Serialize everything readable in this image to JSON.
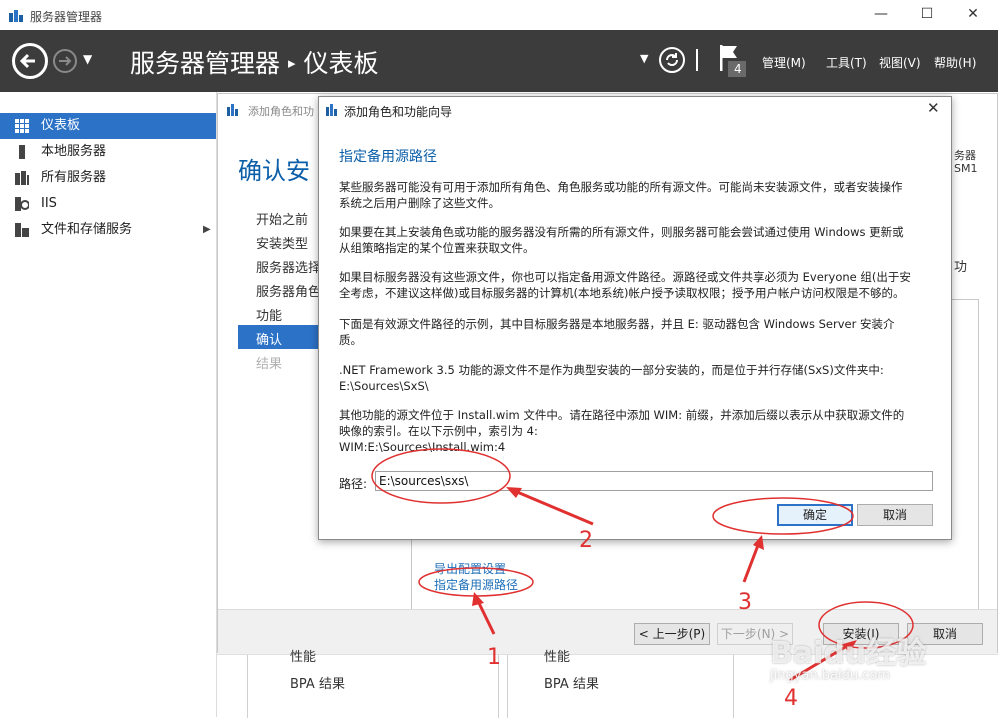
{
  "window": {
    "title": "服务器管理器"
  },
  "header": {
    "breadcrumb_app": "服务器管理器",
    "breadcrumb_sep": "▸",
    "breadcrumb_page": "仪表板",
    "notification_count": "4",
    "menus": [
      "管理(M)",
      "工具(T)",
      "视图(V)",
      "帮助(H)"
    ]
  },
  "leftnav": {
    "items": [
      "仪表板",
      "本地服务器",
      "所有服务器",
      "IIS",
      "文件和存储服务"
    ],
    "active_index": 0
  },
  "bg_wizard": {
    "title": "添加角色和功",
    "heading": "确认安",
    "steps": [
      "开始之前",
      "安装类型",
      "服务器选择",
      "服务器角色",
      "功能",
      "确认",
      "结果"
    ],
    "active_step": 5,
    "right_text_1": "务器",
    "right_text_2": "SM1",
    "right_text_3": "功",
    "export_link": "导出配置设置",
    "source_link": "指定备用源路径",
    "buttons": {
      "prev": "< 上一步(P)",
      "next": "下一步(N) >",
      "install": "安装(I)",
      "cancel": "取消"
    }
  },
  "bottom": {
    "left_a": "性能",
    "left_b": "BPA 结果",
    "right_a": "性能",
    "right_b": "BPA 结果"
  },
  "dialog": {
    "title": "添加角色和功能向导",
    "heading": "指定备用源路径",
    "paragraphs": [
      "某些服务器可能没有可用于添加所有角色、角色服务或功能的所有源文件。可能尚未安装源文件，或者安装操作\n系统之后用户删除了这些文件。",
      "如果要在其上安装角色或功能的服务器没有所需的所有源文件，则服务器可能会尝试通过使用 Windows 更新或\n从组策略指定的某个位置来获取文件。",
      "如果目标服务器没有这些源文件，你也可以指定备用源文件路径。源路径或文件共享必须为 Everyone 组(出于安\n全考虑，不建议这样做)或目标服务器的计算机(本地系统)帐户授予读取权限；授予用户帐户访问权限是不够的。",
      "下面是有效源文件路径的示例，其中目标服务器是本地服务器，并且 E: 驱动器包含 Windows Server 安装介\n质。",
      ".NET Framework 3.5 功能的源文件不是作为典型安装的一部分安装的，而是位于并行存储(SxS)文件夹中:\n          E:\\Sources\\SxS\\",
      "其他功能的源文件位于 Install.wim 文件中。请在路径中添加 WIM: 前缀，并添加后缀以表示从中获取源文件的\n映像的索引。在以下示例中，索引为 4:\n          WIM:E:\\Sources\\Install.wim:4"
    ],
    "path_label": "路径:",
    "path_value": "E:\\sources\\sxs\\",
    "ok_label": "确定",
    "cancel_label": "取消"
  },
  "annotations": {
    "n1": "1",
    "n2": "2",
    "n3": "3",
    "n4": "4",
    "color": "#e03030"
  },
  "watermark": {
    "text": "Baidu经验",
    "url": "jingyan.baidu.com"
  }
}
